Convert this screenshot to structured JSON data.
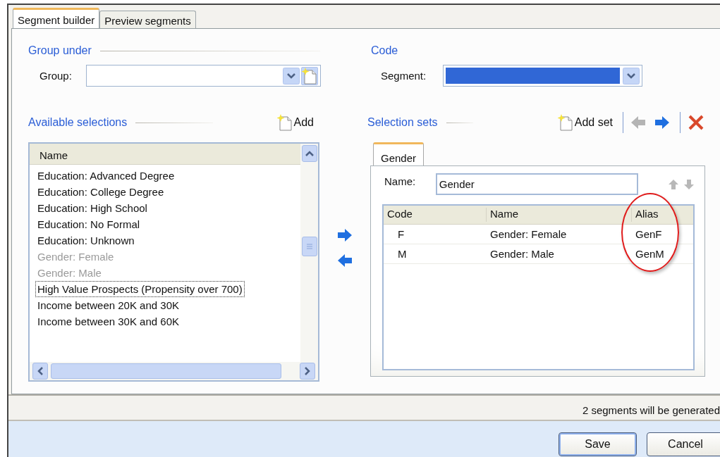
{
  "tabs": [
    {
      "label": "Segment builder",
      "selected": true
    },
    {
      "label": "Preview segments",
      "selected": false
    }
  ],
  "group_under": {
    "heading": "Group under",
    "label": "Group:"
  },
  "code": {
    "heading": "Code",
    "label": "Segment:",
    "selected": true
  },
  "available": {
    "heading": "Available selections",
    "add_label": "Add",
    "column": "Name",
    "items": [
      {
        "label": "Education: Advanced Degree",
        "disabled": false,
        "focused": false
      },
      {
        "label": "Education: College Degree",
        "disabled": false,
        "focused": false
      },
      {
        "label": "Education: High School",
        "disabled": false,
        "focused": false
      },
      {
        "label": "Education: No Formal",
        "disabled": false,
        "focused": false
      },
      {
        "label": "Education: Unknown",
        "disabled": false,
        "focused": false
      },
      {
        "label": "Gender: Female",
        "disabled": true,
        "focused": false
      },
      {
        "label": "Gender: Male",
        "disabled": true,
        "focused": false
      },
      {
        "label": "High Value Prospects (Propensity over 700)",
        "disabled": false,
        "focused": true
      },
      {
        "label": "Income between 20K and 30K",
        "disabled": false,
        "focused": false
      },
      {
        "label": "Income between 30K and 60K",
        "disabled": false,
        "focused": false
      }
    ]
  },
  "selection_sets": {
    "heading": "Selection sets",
    "add_label": "Add set",
    "previous_disabled": true,
    "next_disabled": false,
    "tabs": [
      {
        "label": "Gender",
        "selected": true
      }
    ],
    "name_label": "Name:",
    "name_value": "Gender",
    "columns": [
      "Code",
      "Name",
      "Alias"
    ],
    "rows": [
      [
        "F",
        "Gender: Female",
        "GenF"
      ],
      [
        "M",
        "Gender: Male",
        "GenM"
      ]
    ]
  },
  "status": "2 segments will be generated",
  "buttons": [
    {
      "label": "Save",
      "default": true
    },
    {
      "label": "Cancel",
      "default": false
    }
  ]
}
